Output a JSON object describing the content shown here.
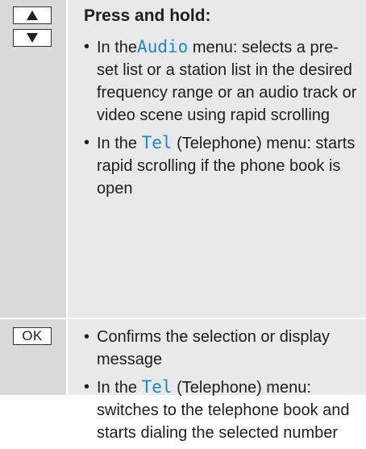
{
  "row1": {
    "heading": "Press and hold:",
    "bullets": [
      {
        "pre": "In the",
        "menu": "Audio",
        "post": " menu: selects a pre-set list or a station list in the desired frequency range or an audio track or video scene using rapid scrolling"
      },
      {
        "pre": "In the ",
        "menu": "Tel",
        "post": " (Telephone) menu: starts rapid scrolling if the phone book is open"
      }
    ]
  },
  "row2": {
    "key_label": "OK",
    "bullets": [
      {
        "text": "Confirms the selection or display message"
      },
      {
        "pre": "In the ",
        "menu": "Tel",
        "post": " (Telephone) menu: switches to the telephone book and starts dialing the selected number"
      }
    ]
  },
  "colors": {
    "menu_text": "#1f86c8",
    "key_column": "#d9d9d9",
    "description_column": "#e9e9e9"
  },
  "icons": [
    "up-arrow-key-icon",
    "down-arrow-key-icon",
    "ok-key-icon"
  ]
}
